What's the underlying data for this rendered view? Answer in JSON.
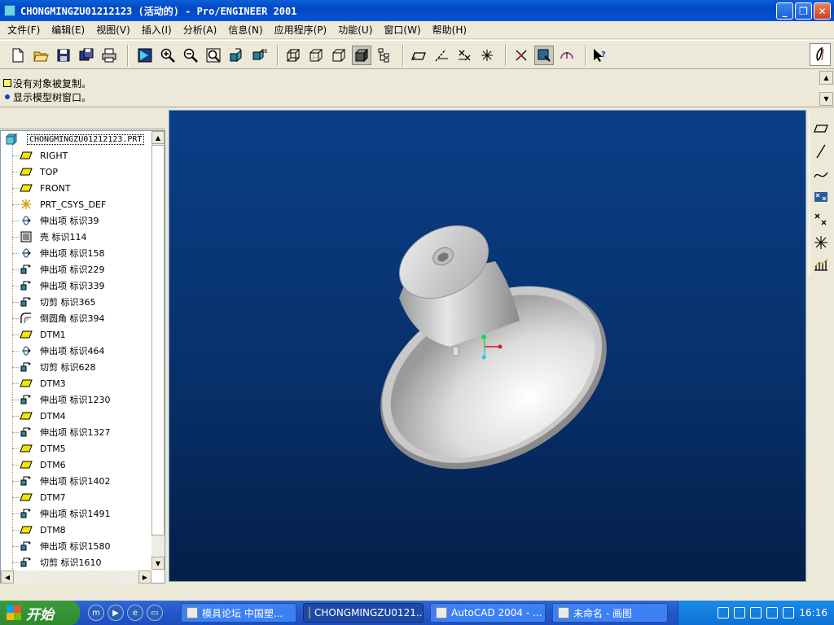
{
  "window": {
    "title": "CHONGMINGZU01212123 (活动的) - Pro/ENGINEER 2001"
  },
  "menu": [
    "文件(F)",
    "编辑(E)",
    "视图(V)",
    "插入(I)",
    "分析(A)",
    "信息(N)",
    "应用程序(P)",
    "功能(U)",
    "窗口(W)",
    "帮助(H)"
  ],
  "toolbar_icons": [
    "new-icon",
    "open-icon",
    "save-icon",
    "save-copy-icon",
    "print-icon",
    "repaint-icon",
    "zoom-in-icon",
    "zoom-out-icon",
    "refit-icon",
    "orient-icon",
    "saved-views-icon",
    "wireframe-icon",
    "hidden-line-icon",
    "no-hidden-icon",
    "shading-icon",
    "model-tree-icon",
    "datum-planes-icon",
    "datum-axes-icon",
    "datum-points-icon",
    "coord-sys-icon",
    "spin-center-icon",
    "view-mode-icon",
    "sketch-icon",
    "whats-this-icon"
  ],
  "messages": [
    "没有对象被复制。",
    "显示模型树窗口。"
  ],
  "model_tree": {
    "root": "CHONGMINGZU01212123.PRT",
    "items": [
      {
        "label": "RIGHT",
        "icon": "datum-plane-icon"
      },
      {
        "label": "TOP",
        "icon": "datum-plane-icon"
      },
      {
        "label": "FRONT",
        "icon": "datum-plane-icon"
      },
      {
        "label": "PRT_CSYS_DEF",
        "icon": "csys-icon"
      },
      {
        "label": "伸出项 标识39",
        "icon": "revolve-icon"
      },
      {
        "label": "壳 标识114",
        "icon": "shell-icon"
      },
      {
        "label": "伸出项 标识158",
        "icon": "revolve-icon"
      },
      {
        "label": "伸出项 标识229",
        "icon": "extrude-icon"
      },
      {
        "label": "伸出项 标识339",
        "icon": "extrude-icon"
      },
      {
        "label": "切剪 标识365",
        "icon": "extrude-icon"
      },
      {
        "label": "倒圆角 标识394",
        "icon": "round-icon"
      },
      {
        "label": "DTM1",
        "icon": "datum-plane-icon"
      },
      {
        "label": "伸出项 标识464",
        "icon": "revolve-icon"
      },
      {
        "label": "切剪 标识628",
        "icon": "extrude-icon"
      },
      {
        "label": "DTM3",
        "icon": "datum-plane-icon"
      },
      {
        "label": "伸出项 标识1230",
        "icon": "extrude-icon"
      },
      {
        "label": "DTM4",
        "icon": "datum-plane-icon"
      },
      {
        "label": "伸出项 标识1327",
        "icon": "extrude-icon"
      },
      {
        "label": "DTM5",
        "icon": "datum-plane-icon"
      },
      {
        "label": "DTM6",
        "icon": "datum-plane-icon"
      },
      {
        "label": "伸出项 标识1402",
        "icon": "extrude-icon"
      },
      {
        "label": "DTM7",
        "icon": "datum-plane-icon"
      },
      {
        "label": "伸出项 标识1491",
        "icon": "extrude-icon"
      },
      {
        "label": "DTM8",
        "icon": "datum-plane-icon"
      },
      {
        "label": "伸出项 标识1580",
        "icon": "extrude-icon"
      },
      {
        "label": "切剪 标识1610",
        "icon": "extrude-icon"
      }
    ]
  },
  "right_toolbar_icons": [
    "datum-plane-tool-icon",
    "datum-axis-tool-icon",
    "datum-curve-tool-icon",
    "datum-point-tool-icon",
    "datum-point-offset-icon",
    "csys-tool-icon",
    "analysis-tool-icon"
  ],
  "taskbar": {
    "start_label": "开始",
    "tasks": [
      {
        "label": "模具论坛 中国塑..."
      },
      {
        "label": "CHONGMINGZU0121..."
      },
      {
        "label": "AutoCAD 2004 - ..."
      },
      {
        "label": "未命名 - 画图"
      }
    ],
    "clock": "16:16"
  },
  "colors": {
    "viewport_top": "#0a3f88",
    "viewport_bottom": "#041f48",
    "datum_plane": "#f2e600",
    "titlebar": "#0348c4"
  }
}
